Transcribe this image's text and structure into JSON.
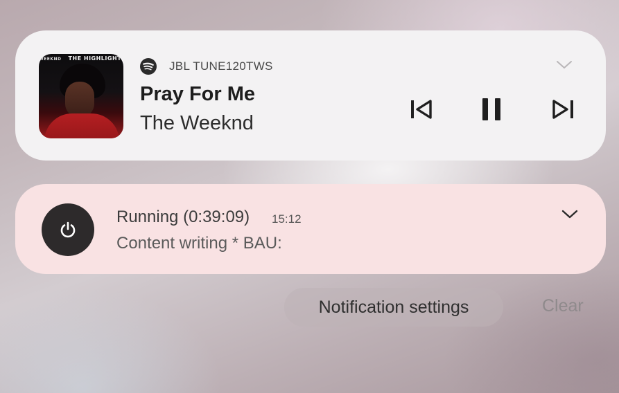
{
  "media": {
    "source_icon": "spotify-icon",
    "device": "JBL TUNE120TWS",
    "title": "Pray For Me",
    "artist": "The Weeknd",
    "album_art": {
      "artist_mark": "WEEKND",
      "header_text": "THE HIGHLIGHTS"
    },
    "controls": [
      "previous-icon",
      "pause-icon",
      "next-icon"
    ]
  },
  "timer_notification": {
    "icon": "power-icon",
    "title": "Running (0:39:09)",
    "time": "15:12",
    "subtitle": "Content writing * BAU:"
  },
  "actions": {
    "settings_label": "Notification settings",
    "clear_label": "Clear"
  },
  "colors": {
    "media_card_bg": "#f3f2f3",
    "timer_card_bg": "#f9e2e3",
    "power_badge_bg": "#2d2a2b"
  }
}
